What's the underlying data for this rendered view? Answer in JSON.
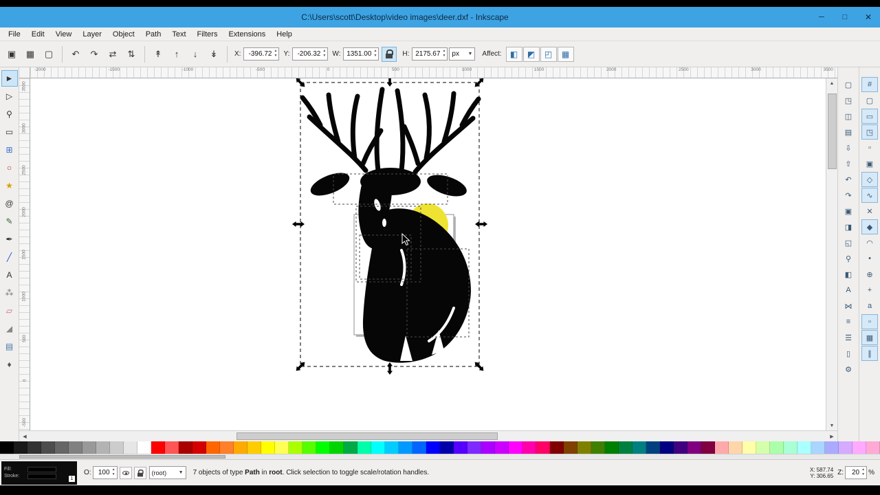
{
  "window": {
    "title": "C:\\Users\\scott\\Desktop\\video images\\deer.dxf - Inkscape",
    "minimize": "─",
    "maximize": "□",
    "close": "✕"
  },
  "menu": {
    "items": [
      "File",
      "Edit",
      "View",
      "Layer",
      "Object",
      "Path",
      "Text",
      "Filters",
      "Extensions",
      "Help"
    ]
  },
  "toolbar": {
    "select_buttons": [
      {
        "name": "select-all",
        "glyph": "▣"
      },
      {
        "name": "select-all-layers",
        "glyph": "▦"
      },
      {
        "name": "deselect",
        "glyph": "▢"
      }
    ],
    "transform_buttons": [
      {
        "name": "rotate-ccw",
        "glyph": "↶"
      },
      {
        "name": "rotate-cw",
        "glyph": "↷"
      },
      {
        "name": "flip-horizontal",
        "glyph": "⇄"
      },
      {
        "name": "flip-vertical",
        "glyph": "⇅"
      }
    ],
    "zorder_buttons": [
      {
        "name": "raise-to-top",
        "glyph": "↟"
      },
      {
        "name": "raise",
        "glyph": "↑"
      },
      {
        "name": "lower",
        "glyph": "↓"
      },
      {
        "name": "lower-to-bottom",
        "glyph": "↡"
      }
    ],
    "fields": {
      "x_label": "X:",
      "x": "-396.72",
      "y_label": "Y:",
      "y": "-206.32",
      "w_label": "W:",
      "w": "1351.00",
      "h_label": "H:",
      "h": "2175.67",
      "unit": "px",
      "affect_label": "Affect:"
    },
    "affect_buttons": [
      {
        "name": "affect-stroke",
        "glyph": "◧"
      },
      {
        "name": "affect-corners",
        "glyph": "◩"
      },
      {
        "name": "affect-gradients",
        "glyph": "◰"
      },
      {
        "name": "affect-patterns",
        "glyph": "▦"
      }
    ]
  },
  "rulers": {
    "top": [
      "-2000",
      "-1500",
      "-1000",
      "-500",
      "0",
      "500",
      "1000",
      "1500",
      "2000",
      "2500",
      "3000",
      "3500"
    ],
    "left": [
      "3500",
      "3000",
      "2500",
      "2000",
      "1500",
      "1000",
      "500",
      "0",
      "-500"
    ]
  },
  "tools": [
    {
      "name": "selector",
      "glyph": "►",
      "active": true
    },
    {
      "name": "node-editor",
      "glyph": "▷"
    },
    {
      "name": "zoom",
      "glyph": "⚲"
    },
    {
      "name": "rectangle",
      "glyph": "▭"
    },
    {
      "name": "box-3d",
      "glyph": "⊞",
      "color": "#3b6ecc"
    },
    {
      "name": "ellipse",
      "glyph": "○",
      "color": "#aa3333"
    },
    {
      "name": "star",
      "glyph": "★",
      "color": "#d8a000"
    },
    {
      "name": "spiral",
      "glyph": "@"
    },
    {
      "name": "pencil",
      "glyph": "✎",
      "color": "#336633"
    },
    {
      "name": "pen",
      "glyph": "✒"
    },
    {
      "name": "calligraphy",
      "glyph": "╱",
      "color": "#2255cc"
    },
    {
      "name": "text",
      "glyph": "A"
    },
    {
      "name": "spray",
      "glyph": "⁂",
      "color": "#777777"
    },
    {
      "name": "eraser",
      "glyph": "▱",
      "color": "#cc6688"
    },
    {
      "name": "paint-bucket",
      "glyph": "◢",
      "color": "#888888"
    },
    {
      "name": "gradient",
      "glyph": "▤",
      "color": "#4477aa"
    },
    {
      "name": "dropper",
      "glyph": "♦",
      "color": "#555555"
    }
  ],
  "commands_right": [
    {
      "name": "new-document",
      "glyph": "▢"
    },
    {
      "name": "open-document",
      "glyph": "◳"
    },
    {
      "name": "save-document",
      "glyph": "◫"
    },
    {
      "name": "print-document",
      "glyph": "▤"
    },
    {
      "name": "import",
      "glyph": "⇩"
    },
    {
      "name": "export",
      "glyph": "⇧"
    },
    {
      "name": "undo",
      "glyph": "↶"
    },
    {
      "name": "redo",
      "glyph": "↷"
    },
    {
      "name": "copy",
      "glyph": "▣"
    },
    {
      "name": "paste",
      "glyph": "◨"
    },
    {
      "name": "duplicate",
      "glyph": "◱"
    },
    {
      "name": "zoom-drawing",
      "glyph": "⚲"
    },
    {
      "name": "fill-stroke-dialog",
      "glyph": "◧"
    },
    {
      "name": "text-dialog",
      "glyph": "A"
    },
    {
      "name": "xml-editor",
      "glyph": "⋈"
    },
    {
      "name": "align-distribute",
      "glyph": "≡"
    },
    {
      "name": "layers-dialog",
      "glyph": "☰"
    },
    {
      "name": "document-properties",
      "glyph": "▯"
    },
    {
      "name": "preferences",
      "glyph": "⚙"
    }
  ],
  "snap_right": [
    {
      "name": "snap-enable",
      "glyph": "#",
      "active": true
    },
    {
      "name": "snap-bbox",
      "glyph": "▢"
    },
    {
      "name": "snap-bbox-edges",
      "glyph": "▭",
      "active": true
    },
    {
      "name": "snap-bbox-corners",
      "glyph": "◳",
      "active": true
    },
    {
      "name": "snap-bbox-edge-midpoints",
      "glyph": "▫"
    },
    {
      "name": "snap-bbox-centers",
      "glyph": "▣"
    },
    {
      "name": "snap-nodes",
      "glyph": "◇",
      "active": true
    },
    {
      "name": "snap-path",
      "glyph": "∿",
      "active": true
    },
    {
      "name": "snap-path-intersections",
      "glyph": "✕"
    },
    {
      "name": "snap-cusp-nodes",
      "glyph": "◆",
      "active": true
    },
    {
      "name": "snap-smooth-nodes",
      "glyph": "◠"
    },
    {
      "name": "snap-line-midpoints",
      "glyph": "•"
    },
    {
      "name": "snap-object-centers",
      "glyph": "⊕"
    },
    {
      "name": "snap-rotation-centers",
      "glyph": "+"
    },
    {
      "name": "snap-text-baseline",
      "glyph": "a"
    },
    {
      "name": "snap-page-border",
      "glyph": "▫",
      "active": true
    },
    {
      "name": "snap-grid",
      "glyph": "▦",
      "active": true
    },
    {
      "name": "snap-guides",
      "glyph": "∥",
      "active": true
    }
  ],
  "palette": {
    "colors": [
      "#000000",
      "#1a1a1a",
      "#333333",
      "#4d4d4d",
      "#666666",
      "#808080",
      "#999999",
      "#b3b3b3",
      "#cccccc",
      "#e6e6e6",
      "#ffffff",
      "#ff0000",
      "#ff5555",
      "#aa0000",
      "#d40000",
      "#ff6600",
      "#ff7f2a",
      "#ffaa00",
      "#ffcc00",
      "#ffff00",
      "#ffff55",
      "#aaff00",
      "#55ff00",
      "#00ff00",
      "#00d400",
      "#00aa44",
      "#00ffaa",
      "#00ffff",
      "#00ccff",
      "#0099ff",
      "#0066ff",
      "#0000ff",
      "#0000aa",
      "#5500ff",
      "#7f2aff",
      "#aa00ff",
      "#cc00ff",
      "#ff00ff",
      "#ff00aa",
      "#ff0066",
      "#800000",
      "#804000",
      "#808000",
      "#408000",
      "#008000",
      "#008040",
      "#008080",
      "#004080",
      "#000080",
      "#400080",
      "#800080",
      "#800040",
      "#ffaaaa",
      "#ffd5aa",
      "#ffffaa",
      "#d5ffaa",
      "#aaffaa",
      "#aaffd5",
      "#aaffff",
      "#aad5ff",
      "#aaaaff",
      "#d5aaff",
      "#ffaaff",
      "#ffaad5"
    ]
  },
  "status": {
    "fill_label": "Fill:",
    "stroke_label": "Stroke:",
    "stroke_width": "1",
    "opacity_label": "O:",
    "opacity": "100",
    "layer": "(root)",
    "m1": "7 objects of type ",
    "m2": "Path",
    "m3": " in ",
    "m4": "root",
    "m5": ". Click selection to toggle scale/rotation handles.",
    "x_label": "X:",
    "x_value": "587.74",
    "y_label": "Y:",
    "y_value": "306.65",
    "z_label": "Z:",
    "zoom": "20",
    "zoom_suffix": "%"
  },
  "scene": {
    "deer_color": "#060606",
    "highlight_color": "#eee332",
    "page_fill": "#ffffff",
    "page_border": "#8f8f8f",
    "selection_color": "#000000",
    "subselect_color": "#4a4a4a"
  }
}
